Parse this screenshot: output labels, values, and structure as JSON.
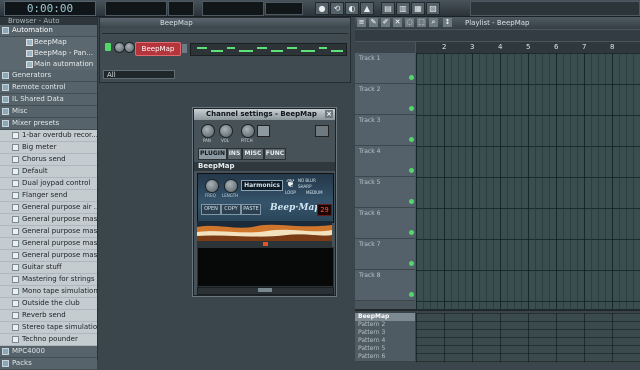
{
  "transport": {
    "time": "0:00:00"
  },
  "browser": {
    "title": "Browser - Auto",
    "items": [
      {
        "label": "Automation",
        "kind": "folder"
      },
      {
        "label": "BeepMap",
        "kind": "sub"
      },
      {
        "label": "BeepMap - Pan...",
        "kind": "sub"
      },
      {
        "label": "Main automation",
        "kind": "sub"
      },
      {
        "label": "Generators",
        "kind": "folder"
      },
      {
        "label": "Remote control",
        "kind": "folder"
      },
      {
        "label": "IL Shared Data",
        "kind": "folder"
      },
      {
        "label": "Misc",
        "kind": "folder"
      },
      {
        "label": "Mixer presets",
        "kind": "folder"
      },
      {
        "label": "1-bar overdub recor...",
        "kind": "preset"
      },
      {
        "label": "Big meter",
        "kind": "preset"
      },
      {
        "label": "Chorus send",
        "kind": "preset"
      },
      {
        "label": "Default",
        "kind": "preset"
      },
      {
        "label": "Dual joypad control",
        "kind": "preset"
      },
      {
        "label": "Flanger send",
        "kind": "preset"
      },
      {
        "label": "General purpose air ...",
        "kind": "preset"
      },
      {
        "label": "General purpose mas...",
        "kind": "preset"
      },
      {
        "label": "General purpose mas...",
        "kind": "preset"
      },
      {
        "label": "General purpose mas...",
        "kind": "preset"
      },
      {
        "label": "General purpose mas...",
        "kind": "preset"
      },
      {
        "label": "Guitar stuff",
        "kind": "preset"
      },
      {
        "label": "Mastering for strings",
        "kind": "preset"
      },
      {
        "label": "Mono tape simulation",
        "kind": "preset"
      },
      {
        "label": "Outside the club",
        "kind": "preset"
      },
      {
        "label": "Reverb send",
        "kind": "preset"
      },
      {
        "label": "Stereo tape simulation",
        "kind": "preset"
      },
      {
        "label": "Techno pounder",
        "kind": "preset"
      },
      {
        "label": "MPC4000",
        "kind": "folder"
      },
      {
        "label": "Packs",
        "kind": "folder"
      }
    ]
  },
  "step_sequencer": {
    "title": "BeepMap",
    "channel_button": "BeepMap",
    "filter": "All"
  },
  "channel_settings": {
    "title": "Channel settings - BeepMap",
    "knobs": [
      "PAN",
      "VOL",
      "PITCH"
    ],
    "tabs": [
      "PLUGIN",
      "INS",
      "MISC",
      "FUNC"
    ],
    "plugin_name": "BeepMap",
    "plugin": {
      "mode": "Harmonics",
      "knobs": [
        "FREQ",
        "LENGTH"
      ],
      "options": [
        "NO BLUR",
        "SHARP",
        "LOOP",
        "MEDIUM"
      ],
      "buttons": [
        "OPEN",
        "COPY",
        "PASTE"
      ],
      "logo": "Beep·Map",
      "value": "29"
    }
  },
  "playlist": {
    "title": "Playlist - BeepMap",
    "ruler": [
      "2",
      "3",
      "4",
      "5",
      "6",
      "7",
      "8"
    ],
    "tracks": [
      "Track 1",
      "Track 2",
      "Track 3",
      "Track 4",
      "Track 5",
      "Track 6",
      "Track 7",
      "Track 8"
    ],
    "patterns": [
      "BeepMap",
      "Pattern 2",
      "Pattern 3",
      "Pattern 4",
      "Pattern 5",
      "Pattern 6"
    ]
  },
  "colors": {
    "accent_green": "#53d66a",
    "channel_red": "#b4353c"
  }
}
